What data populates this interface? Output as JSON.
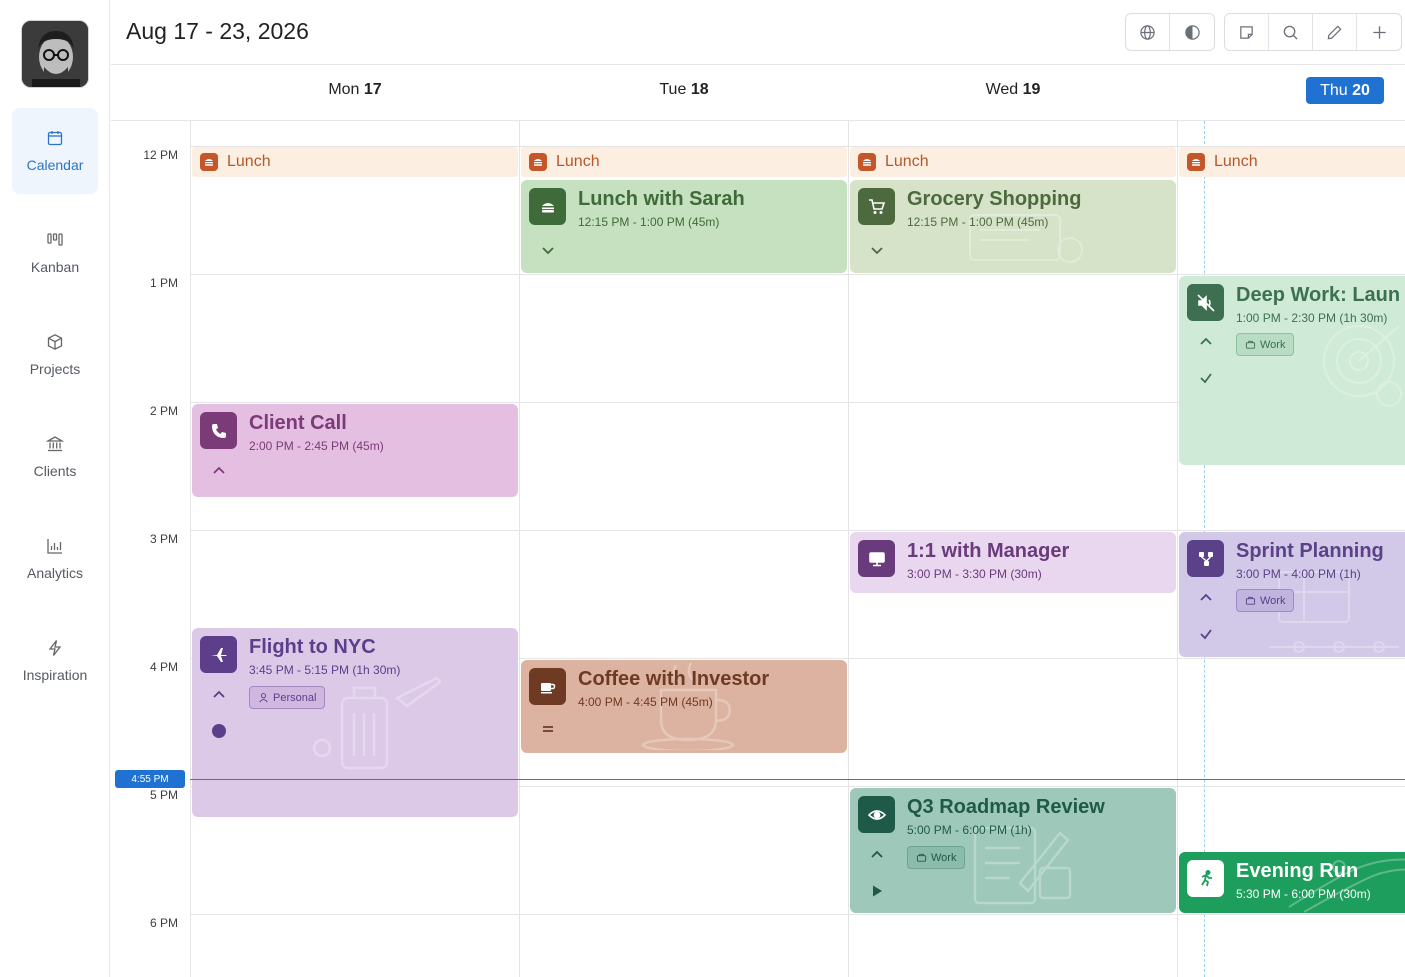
{
  "header": {
    "title": "Aug 17 - 23, 2026"
  },
  "toolbar": {
    "group1": [
      "globe-icon",
      "contrast-icon"
    ],
    "group2": [
      "note-icon",
      "search-icon",
      "pencil-icon",
      "plus-icon"
    ]
  },
  "sidebar": {
    "items": [
      {
        "label": "Calendar",
        "icon": "calendar-icon",
        "active": true
      },
      {
        "label": "Kanban",
        "icon": "kanban-icon"
      },
      {
        "label": "Projects",
        "icon": "box-icon"
      },
      {
        "label": "Clients",
        "icon": "bank-icon"
      },
      {
        "label": "Analytics",
        "icon": "chart-icon"
      },
      {
        "label": "Inspiration",
        "icon": "bolt-icon"
      }
    ]
  },
  "days": [
    {
      "dow": "Mon",
      "num": "17"
    },
    {
      "dow": "Tue",
      "num": "18"
    },
    {
      "dow": "Wed",
      "num": "19"
    },
    {
      "dow": "Thu",
      "num": "20",
      "today": true
    }
  ],
  "hours": [
    "12 PM",
    "1 PM",
    "2 PM",
    "3 PM",
    "4 PM",
    "5 PM",
    "6 PM"
  ],
  "now": {
    "label": "4:55 PM"
  },
  "lunch": {
    "label": "Lunch"
  },
  "events": {
    "lunch_sarah": {
      "title": "Lunch with Sarah",
      "time": "12:15 PM - 1:00 PM (45m)",
      "color": "#c5e1bf",
      "accent": "#3f6b3a"
    },
    "grocery": {
      "title": "Grocery Shopping",
      "time": "12:15 PM - 1:00 PM (45m)",
      "color": "#d6e3c8",
      "accent": "#4d6a3f"
    },
    "deep_work": {
      "title": "Deep Work: Laun",
      "time": "1:00 PM - 2:30 PM (1h 30m)",
      "tag": "Work",
      "color": "#cfead6",
      "accent": "#3d7050"
    },
    "client_call": {
      "title": "Client Call",
      "time": "2:00 PM - 2:45 PM (45m)",
      "color": "#e4bfe2",
      "accent": "#7b3a78"
    },
    "one_on_one": {
      "title": "1:1 with Manager",
      "time": "3:00 PM - 3:30 PM (30m)",
      "color": "#e8d7ee",
      "accent": "#6a3b7c"
    },
    "sprint": {
      "title": "Sprint Planning",
      "time": "3:00 PM - 4:00 PM (1h)",
      "tag": "Work",
      "color": "#d2c9e8",
      "accent": "#5a4188"
    },
    "flight": {
      "title": "Flight to NYC",
      "time": "3:45 PM - 5:15 PM (1h 30m)",
      "tag": "Personal",
      "color": "#dcc9e8",
      "accent": "#5d3e8a"
    },
    "coffee": {
      "title": "Coffee with Investor",
      "time": "4:00 PM - 4:45 PM (45m)",
      "color": "#dcb3a0",
      "accent": "#6e3a24"
    },
    "q3": {
      "title": "Q3 Roadmap Review",
      "time": "5:00 PM - 6:00 PM (1h)",
      "tag": "Work",
      "color": "#9ec8b9",
      "accent": "#1f5a48"
    },
    "run": {
      "title": "Evening Run",
      "time": "5:30 PM - 6:00 PM (30m)",
      "color": "#1e9e5c",
      "accent": "#ffffff"
    }
  }
}
